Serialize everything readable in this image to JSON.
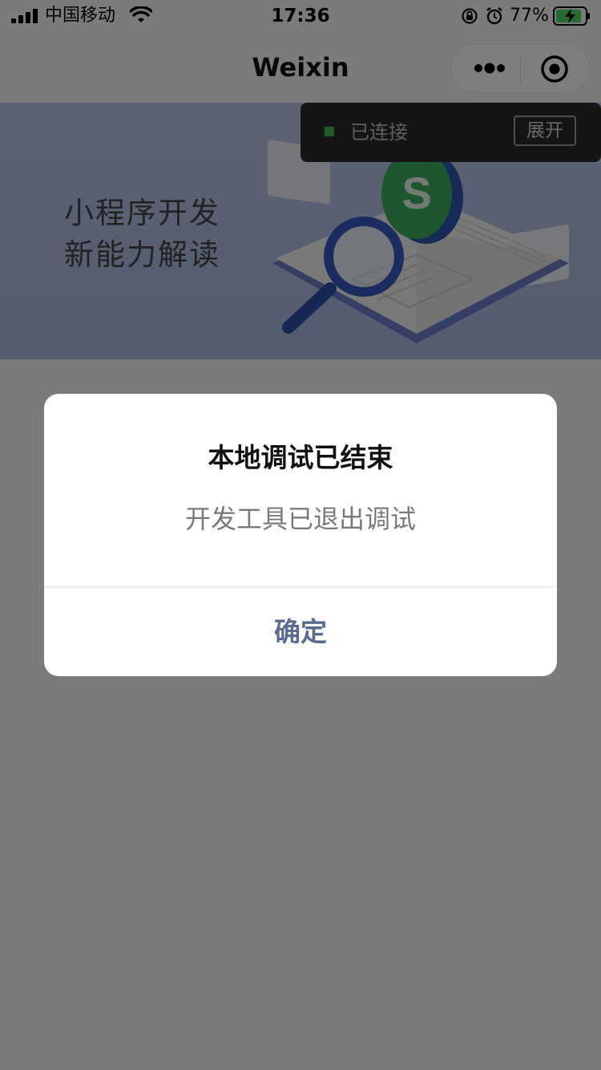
{
  "status_bar": {
    "carrier": "中国移动",
    "time": "17:36",
    "battery_percent": "77%",
    "icons": [
      "signal-icon",
      "wifi-icon",
      "rotation-lock-icon",
      "alarm-icon",
      "battery-charging-icon"
    ]
  },
  "nav": {
    "title": "Weixin",
    "more_icon": "more-dots-icon",
    "close_icon": "target-close-icon"
  },
  "banner": {
    "line1": "小程序开发",
    "line2": "新能力解读"
  },
  "connection": {
    "status": "已连接",
    "expand_label": "展开",
    "status_color": "#3ebd4a"
  },
  "dialog": {
    "title": "本地调试已结束",
    "message": "开发工具已退出调试",
    "confirm_label": "确定",
    "confirm_color": "#576b95"
  }
}
